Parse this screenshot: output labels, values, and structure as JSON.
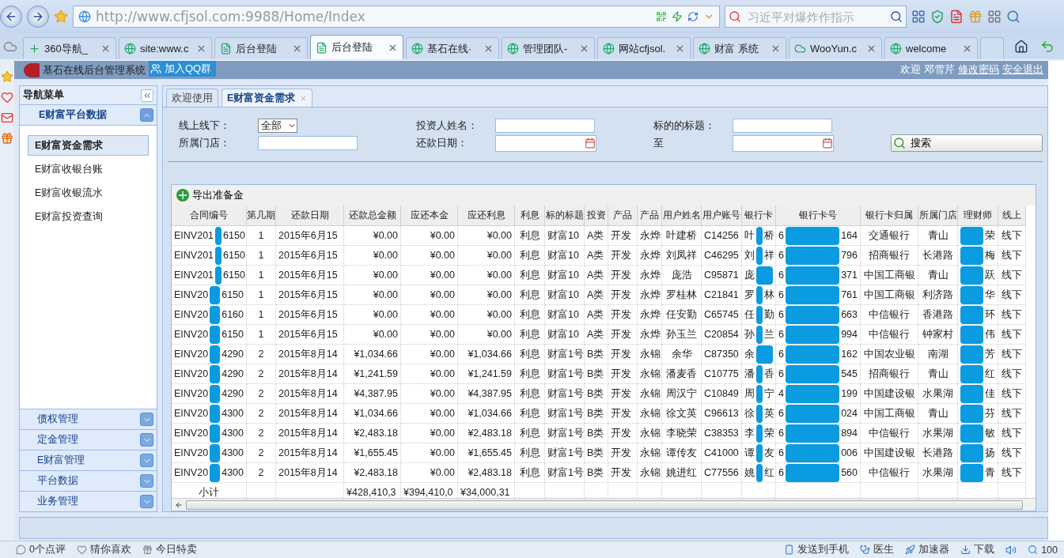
{
  "browser": {
    "url": "http://www.cfjsol.com:9988/Home/Index",
    "search_placeholder": "习近平对爆炸作指示",
    "tabs": [
      {
        "label": "360导航_",
        "selected": false
      },
      {
        "label": "site:www.c",
        "selected": false
      },
      {
        "label": "后台登陆",
        "selected": false
      },
      {
        "label": "后台登陆",
        "selected": true
      },
      {
        "label": "基石在线·",
        "selected": false
      },
      {
        "label": "管理团队-",
        "selected": false
      },
      {
        "label": "网站cfjsol.",
        "selected": false
      },
      {
        "label": "财富 系统",
        "selected": false
      },
      {
        "label": "WooYun.c",
        "selected": false
      },
      {
        "label": "welcome",
        "selected": false
      }
    ],
    "status_items": [
      "0个点评",
      "猜你喜欢",
      "今日特卖"
    ],
    "status_right": [
      "发送到手机",
      "医生",
      "加速器",
      "下载"
    ],
    "zoom": "100"
  },
  "header": {
    "title": "基石在线后台管理系统",
    "qq_button": "加入QQ群",
    "welcome": "欢迎",
    "user": "邓雪芹",
    "links": [
      "修改密码",
      "安全退出"
    ]
  },
  "nav": {
    "title": "导航菜单",
    "section": {
      "label": "E财富平台数据",
      "expanded": true
    },
    "items": [
      {
        "label": "E财富资金需求",
        "selected": true
      },
      {
        "label": "E财富收银台账",
        "selected": false
      },
      {
        "label": "E财富收银流水",
        "selected": false
      },
      {
        "label": "E财富投资查询",
        "selected": false
      }
    ],
    "groups": [
      {
        "label": "债权管理",
        "expanded": false
      },
      {
        "label": "定金管理",
        "expanded": false
      },
      {
        "label": "E财富管理",
        "expanded": false
      },
      {
        "label": "平台数据",
        "expanded": false
      },
      {
        "label": "业务管理",
        "expanded": false
      }
    ]
  },
  "content_tabs": [
    {
      "label": "欢迎使用",
      "selected": false,
      "closable": false
    },
    {
      "label": "E财富资金需求",
      "selected": true,
      "closable": true
    }
  ],
  "filters": {
    "online_label": "线上线下：",
    "online_value": "全部",
    "investor_label": "投资人姓名：",
    "title_label": "标的的标题：",
    "store_label": "所属门店：",
    "date_label": "还款日期：",
    "to_label": "至",
    "search_button": "搜索"
  },
  "toolbar": {
    "export_button": "导出准备金"
  },
  "table": {
    "columns": [
      {
        "label": "合同编号",
        "redacted": true
      },
      {
        "label": "第几期",
        "redacted": false
      },
      {
        "label": "还款日期",
        "redacted": false
      },
      {
        "label": "还款总金额",
        "redacted": false
      },
      {
        "label": "应还本金",
        "redacted": false
      },
      {
        "label": "应还利息",
        "redacted": false
      },
      {
        "label": "利息",
        "redacted": false
      },
      {
        "label": "标的标题",
        "redacted": false
      },
      {
        "label": "投资",
        "redacted": false
      },
      {
        "label": "产品",
        "redacted": false
      },
      {
        "label": "产品",
        "redacted": false
      },
      {
        "label": "用户姓名",
        "redacted": false
      },
      {
        "label": "用户账号",
        "redacted": false
      },
      {
        "label": "银行卡",
        "redacted": true
      },
      {
        "label": "银行卡号",
        "redacted": true
      },
      {
        "label": "银行卡归属",
        "redacted": false
      },
      {
        "label": "所属门店",
        "redacted": false
      },
      {
        "label": "理财师",
        "redacted": true
      },
      {
        "label": "线上",
        "redacted": false
      }
    ],
    "rows": [
      [
        {
          "before": "EINV201",
          "after": "6150"
        },
        "1",
        "2015年6月15",
        "¥0.00",
        "¥0.00",
        "¥0.00",
        "利息",
        "财富10",
        "A类",
        "开发",
        "永烨",
        "叶建桥",
        "C14256",
        {
          "before": "叶",
          "after": "桥"
        },
        {
          "before": "6",
          "after": "164"
        },
        "交通银行",
        "青山",
        {
          "after": "荣"
        },
        "线下"
      ],
      [
        {
          "before": "EINV201",
          "after": "6150"
        },
        "1",
        "2015年6月15",
        "¥0.00",
        "¥0.00",
        "¥0.00",
        "利息",
        "财富10",
        "A类",
        "开发",
        "永烨",
        "刘凤祥",
        "C46295",
        {
          "before": "刘",
          "after": "祥"
        },
        {
          "before": "6",
          "after": "796"
        },
        "招商银行",
        "长港路",
        {
          "after": "梅"
        },
        "线下"
      ],
      [
        {
          "before": "EINV201",
          "after": "6150"
        },
        "1",
        "2015年6月15",
        "¥0.00",
        "¥0.00",
        "¥0.00",
        "利息",
        "财富10",
        "A类",
        "开发",
        "永烨",
        "庞浩",
        "C95871",
        {
          "before": "庞"
        },
        {
          "before": "6",
          "after": "371"
        },
        "中国工商银",
        "青山",
        {
          "after": "跃"
        },
        "线下"
      ],
      [
        {
          "before": "EINV20",
          "after": "6150"
        },
        "1",
        "2015年6月15",
        "¥0.00",
        "¥0.00",
        "¥0.00",
        "利息",
        "财富10",
        "A类",
        "开发",
        "永烨",
        "罗桂林",
        "C21841",
        {
          "before": "罗",
          "after": "林"
        },
        {
          "before": "6",
          "after": "761"
        },
        "中国工商银",
        "利济路",
        {
          "after": "华"
        },
        "线下"
      ],
      [
        {
          "before": "EINV20",
          "after": "6160"
        },
        "1",
        "2015年6月15",
        "¥0.00",
        "¥0.00",
        "¥0.00",
        "利息",
        "财富10",
        "A类",
        "开发",
        "永烨",
        "任安勤",
        "C65745",
        {
          "before": "任",
          "after": "勤"
        },
        {
          "before": "6",
          "after": "663"
        },
        "中信银行",
        "香港路",
        {
          "after": "环"
        },
        "线下"
      ],
      [
        {
          "before": "EINV20",
          "after": "6150"
        },
        "1",
        "2015年6月15",
        "¥0.00",
        "¥0.00",
        "¥0.00",
        "利息",
        "财富10",
        "A类",
        "开发",
        "永烨",
        "孙玉兰",
        "C20854",
        {
          "before": "孙",
          "after": "兰"
        },
        {
          "before": "6",
          "after": "994"
        },
        "中信银行",
        "钟家村",
        {
          "after": "伟"
        },
        "线下"
      ],
      [
        {
          "before": "EINV20",
          "after": "4290"
        },
        "2",
        "2015年8月14",
        "¥1,034.66",
        "¥0.00",
        "¥1,034.66",
        "利息",
        "财富1号",
        "B类",
        "开发",
        "永锦",
        "余华",
        "C87350",
        {
          "before": "余"
        },
        {
          "before": "6",
          "after": "162"
        },
        "中国农业银",
        "南湖",
        {
          "after": "芳"
        },
        "线下"
      ],
      [
        {
          "before": "EINV20",
          "after": "4290"
        },
        "2",
        "2015年8月14",
        "¥1,241.59",
        "¥0.00",
        "¥1,241.59",
        "利息",
        "财富1号",
        "B类",
        "开发",
        "永锦",
        "潘麦香",
        "C10775",
        {
          "before": "潘",
          "after": "香"
        },
        {
          "before": "6",
          "after": "545"
        },
        "招商银行",
        "青山",
        {
          "after": "红"
        },
        "线下"
      ],
      [
        {
          "before": "EINV20",
          "after": "4290"
        },
        "2",
        "2015年8月14",
        "¥4,387.95",
        "¥0.00",
        "¥4,387.95",
        "利息",
        "财富1号",
        "B类",
        "开发",
        "永锦",
        "周汉宁",
        "C10849",
        {
          "before": "周",
          "after": "宁"
        },
        {
          "before": "4",
          "after": "199"
        },
        "中国建设银",
        "水果湖",
        {
          "after": "佳"
        },
        "线下"
      ],
      [
        {
          "before": "EINV20",
          "after": "4300"
        },
        "2",
        "2015年8月14",
        "¥1,034.66",
        "¥0.00",
        "¥1,034.66",
        "利息",
        "财富1号",
        "B类",
        "开发",
        "永锦",
        "徐文英",
        "C96613",
        {
          "before": "徐",
          "after": "英"
        },
        {
          "before": "6",
          "after": "024"
        },
        "中国工商银",
        "青山",
        {
          "after": "芬"
        },
        "线下"
      ],
      [
        {
          "before": "EINV20",
          "after": "4300"
        },
        "2",
        "2015年8月14",
        "¥2,483.18",
        "¥0.00",
        "¥2,483.18",
        "利息",
        "财富1号",
        "B类",
        "开发",
        "永锦",
        "李晓荣",
        "C38353",
        {
          "before": "李",
          "after": "荣"
        },
        {
          "before": "6",
          "after": "894"
        },
        "中信银行",
        "水果湖",
        {
          "after": "敏"
        },
        "线下"
      ],
      [
        {
          "before": "EINV20",
          "after": "4300"
        },
        "2",
        "2015年8月14",
        "¥1,655.45",
        "¥0.00",
        "¥1,655.45",
        "利息",
        "财富1号",
        "B类",
        "开发",
        "永锦",
        "谭传友",
        "C41000",
        {
          "before": "谭",
          "after": "友"
        },
        {
          "before": "6",
          "after": "006"
        },
        "中国建设银",
        "长港路",
        {
          "after": "扬"
        },
        "线下"
      ],
      [
        {
          "before": "EINV20",
          "after": "4300"
        },
        "2",
        "2015年8月14",
        "¥2,483.18",
        "¥0.00",
        "¥2,483.18",
        "利息",
        "财富1号",
        "B类",
        "开发",
        "永锦",
        "姚进红",
        "C77556",
        {
          "before": "姚",
          "after": "红"
        },
        {
          "before": "6",
          "after": "560"
        },
        "中信银行",
        "水果湖",
        {
          "after": "青"
        },
        "线下"
      ]
    ],
    "subtotal": {
      "label": "小计",
      "values": [
        "¥428,410,3",
        "¥394,410,0",
        "¥34,000,31"
      ]
    }
  }
}
